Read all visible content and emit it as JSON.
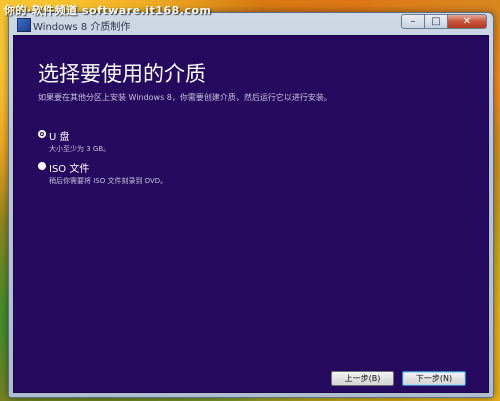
{
  "watermark": "你的·软件频道 software.it168.com",
  "window": {
    "title": "Windows 8 介质制作",
    "controls": {
      "minimize": "–",
      "maximize": "□",
      "close": "✕"
    }
  },
  "page": {
    "heading": "选择要使用的介质",
    "subtitle": "如果要在其他分区上安装 Windows 8，你需要创建介质，然后运行它以进行安装。"
  },
  "options": [
    {
      "label": "U 盘",
      "description": "大小至少为 3 GB。",
      "selected": true
    },
    {
      "label": "ISO 文件",
      "description": "稍后你需要将 ISO 文件刻录到 DVD。",
      "selected": false
    }
  ],
  "buttons": {
    "back": "上一步(B)",
    "next": "下一步(N)"
  },
  "colors": {
    "content_background": "#25095f",
    "text": "#ffffff"
  }
}
